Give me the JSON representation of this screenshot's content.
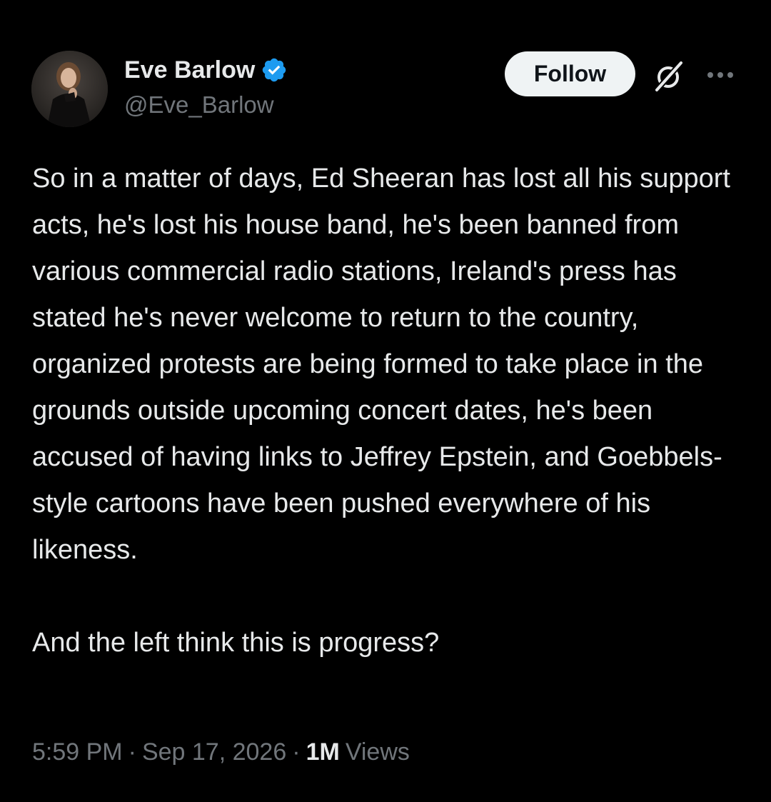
{
  "author": {
    "display_name": "Eve Barlow",
    "handle": "@Eve_Barlow",
    "verified": true,
    "verified_color": "#1d9bf0"
  },
  "actions": {
    "follow_label": "Follow",
    "grok_icon": "grok-icon",
    "more_icon": "more-icon"
  },
  "tweet": {
    "text": "So in a matter of days, Ed Sheeran has lost all his support acts, he's lost his house band, he's been banned from various commercial radio stations, Ireland's press has stated he's never welcome to return to the country, organized protests are being formed to take place in the grounds outside upcoming concert dates, he's been accused of having links to Jeffrey Epstein, and Goebbels-style cartoons have been pushed everywhere of his likeness.\n\nAnd the left think this is progress?"
  },
  "meta": {
    "time": "5:59 PM",
    "separator": "·",
    "date": "Sep 17, 2026",
    "views_count": "1M",
    "views_label": "Views"
  },
  "colors": {
    "background": "#000000",
    "text_primary": "#e7e9ea",
    "text_secondary": "#71767b",
    "follow_bg": "#eff3f4",
    "follow_text": "#0f1419"
  }
}
